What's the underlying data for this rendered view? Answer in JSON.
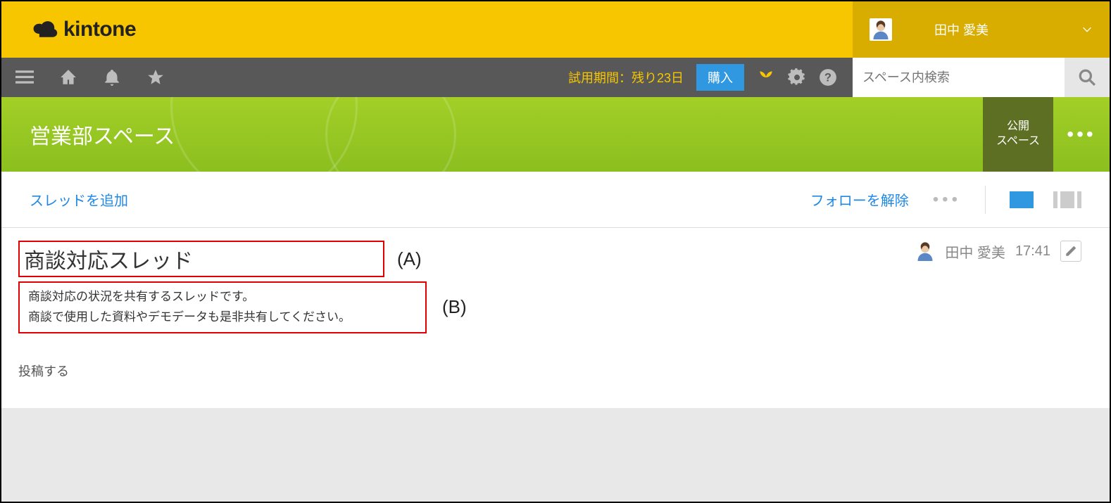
{
  "brand": {
    "name": "kintone"
  },
  "user": {
    "display_name": "田中 愛美"
  },
  "trial": {
    "text": "試用期間：残り23日",
    "buy_label": "購入"
  },
  "search": {
    "placeholder": "スペース内検索"
  },
  "space": {
    "name": "営業部スペース",
    "visibility_line1": "公開",
    "visibility_line2": "スペース"
  },
  "actions": {
    "add_thread": "スレッドを追加",
    "unfollow": "フォローを解除"
  },
  "thread": {
    "title": "商談対応スレッド",
    "title_label": "(A)",
    "desc_line1": "商談対応の状況を共有するスレッドです。",
    "desc_line2": "商談で使用した資料やデモデータも是非共有してください。",
    "desc_label": "(B)",
    "author": "田中 愛美",
    "time": "17:41"
  },
  "compose": {
    "post_label": "投稿する"
  }
}
